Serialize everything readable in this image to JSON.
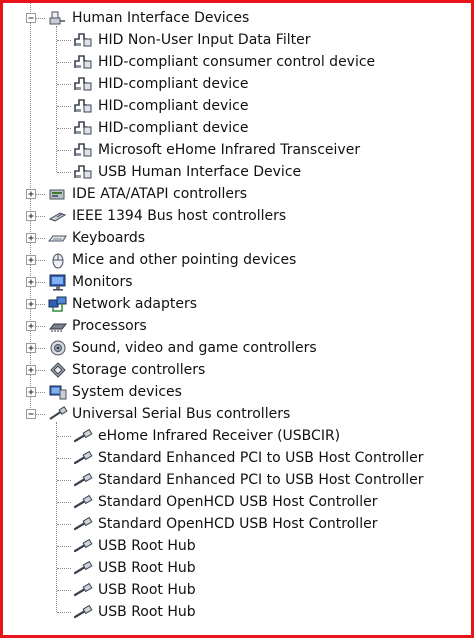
{
  "frame_color": "#e8141a",
  "tree": [
    {
      "label": "Human Interface Devices",
      "level": 0,
      "expanded": true,
      "icon": "hid-category-icon"
    },
    {
      "label": "HID Non-User Input Data Filter",
      "level": 1,
      "icon": "hid-device-icon"
    },
    {
      "label": "HID-compliant consumer control device",
      "level": 1,
      "icon": "hid-device-icon"
    },
    {
      "label": "HID-compliant device",
      "level": 1,
      "icon": "hid-device-icon"
    },
    {
      "label": "HID-compliant device",
      "level": 1,
      "icon": "hid-device-icon"
    },
    {
      "label": "HID-compliant device",
      "level": 1,
      "icon": "hid-device-icon"
    },
    {
      "label": "Microsoft eHome Infrared Transceiver",
      "level": 1,
      "icon": "hid-device-icon"
    },
    {
      "label": "USB Human Interface Device",
      "level": 1,
      "icon": "hid-device-icon"
    },
    {
      "label": "IDE ATA/ATAPI controllers",
      "level": 0,
      "expanded": false,
      "icon": "ide-controller-icon"
    },
    {
      "label": "IEEE 1394 Bus host controllers",
      "level": 0,
      "expanded": false,
      "icon": "firewire-controller-icon"
    },
    {
      "label": "Keyboards",
      "level": 0,
      "expanded": false,
      "icon": "keyboard-icon"
    },
    {
      "label": "Mice and other pointing devices",
      "level": 0,
      "expanded": false,
      "icon": "mouse-icon"
    },
    {
      "label": "Monitors",
      "level": 0,
      "expanded": false,
      "icon": "monitor-icon"
    },
    {
      "label": "Network adapters",
      "level": 0,
      "expanded": false,
      "icon": "network-adapter-icon"
    },
    {
      "label": "Processors",
      "level": 0,
      "expanded": false,
      "icon": "processor-icon"
    },
    {
      "label": "Sound, video and game controllers",
      "level": 0,
      "expanded": false,
      "icon": "speaker-icon"
    },
    {
      "label": "Storage controllers",
      "level": 0,
      "expanded": false,
      "icon": "storage-controller-icon"
    },
    {
      "label": "System devices",
      "level": 0,
      "expanded": false,
      "icon": "system-devices-icon"
    },
    {
      "label": "Universal Serial Bus controllers",
      "level": 0,
      "expanded": true,
      "icon": "usb-category-icon"
    },
    {
      "label": "eHome Infrared Receiver (USBCIR)",
      "level": 1,
      "icon": "usb-plug-icon"
    },
    {
      "label": "Standard Enhanced PCI to USB Host Controller",
      "level": 1,
      "icon": "usb-plug-icon"
    },
    {
      "label": "Standard Enhanced PCI to USB Host Controller",
      "level": 1,
      "icon": "usb-plug-icon"
    },
    {
      "label": "Standard OpenHCD USB Host Controller",
      "level": 1,
      "icon": "usb-plug-icon"
    },
    {
      "label": "Standard OpenHCD USB Host Controller",
      "level": 1,
      "icon": "usb-plug-icon"
    },
    {
      "label": "USB Root Hub",
      "level": 1,
      "icon": "usb-plug-icon"
    },
    {
      "label": "USB Root Hub",
      "level": 1,
      "icon": "usb-plug-icon"
    },
    {
      "label": "USB Root Hub",
      "level": 1,
      "icon": "usb-plug-icon"
    },
    {
      "label": "USB Root Hub",
      "level": 1,
      "icon": "usb-plug-icon"
    }
  ]
}
